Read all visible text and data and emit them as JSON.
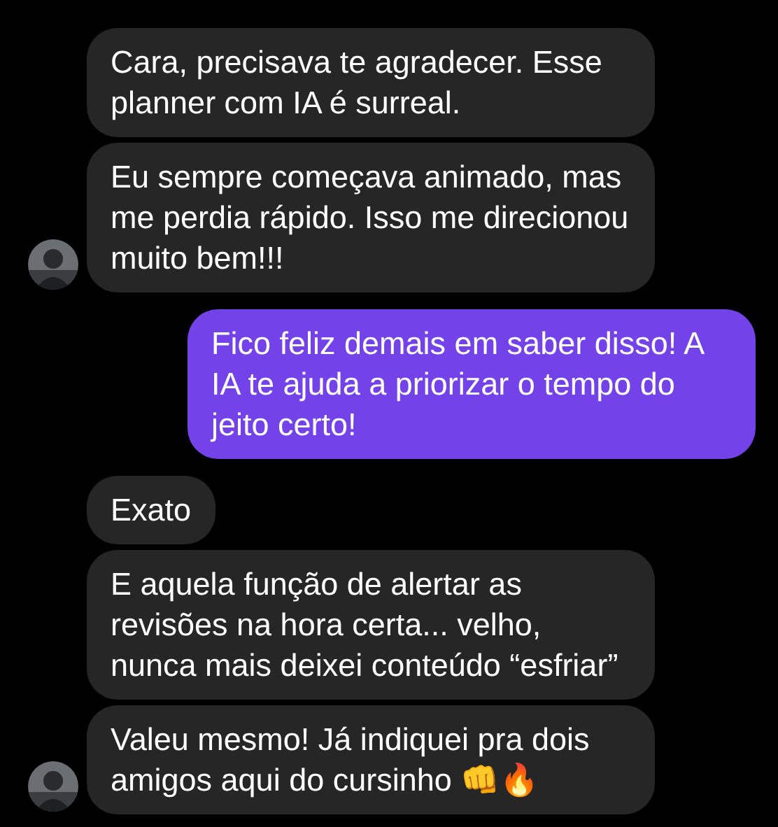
{
  "messages": [
    {
      "kind": "incoming",
      "text": "Cara, precisava te agradecer. Esse planner com IA é surreal."
    },
    {
      "kind": "incoming",
      "text": "Eu sempre começava animado, mas me perdia rápido. Isso me direcionou muito bem!!!",
      "show_avatar": true
    },
    {
      "kind": "outgoing",
      "text": "Fico feliz demais em saber disso! A IA te ajuda a priorizar o tempo do jeito certo!"
    },
    {
      "kind": "incoming",
      "text": "Exato"
    },
    {
      "kind": "incoming",
      "text": "E aquela função de alertar as revisões na hora certa... velho, nunca mais deixei conteúdo “esfriar”"
    },
    {
      "kind": "incoming",
      "text": "Valeu mesmo! Já indiquei pra dois amigos aqui do cursinho 👊🔥",
      "show_avatar": true
    }
  ]
}
